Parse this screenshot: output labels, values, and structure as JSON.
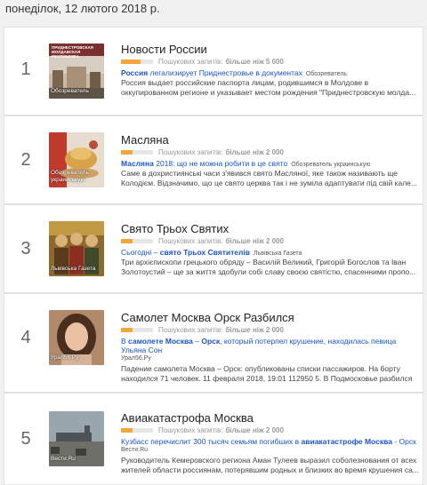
{
  "header": {
    "date": "понеділок, 12 лютого 2018 р."
  },
  "cards": [
    {
      "rank": "1",
      "title": "Новости России",
      "volume_label": "Пошукових запитів:",
      "volume_value": "більше ніж 5 000",
      "volume_fill": 0.6,
      "thumb_caption": "Обозреватель",
      "thumb_top_text": "ПРИДНЕСТРОВСКАЯ МОЛДАВСКАЯ РЕСПУБЛИКА",
      "article_title_parts": [
        "Россия",
        " легализирует Приднестровье в документах"
      ],
      "article_source": "Обозреватель",
      "snippet": "Россия выдает российские паспорта лицам, родившимся в Молдове в оккупированном регионе и указывает местом рождения \"Приднестровскую молда..."
    },
    {
      "rank": "2",
      "title": "Масляна",
      "volume_label": "Пошукових запитів:",
      "volume_value": "більше ніж 2 000",
      "volume_fill": 0.35,
      "thumb_caption": "Обозреватель украинськую",
      "article_title_parts": [
        "Масляна",
        " 2018: що не можна робити в це свято"
      ],
      "article_source": "Обозреватель украинськую",
      "snippet": "Саме в дохристиянські часи з'явився свято Масляної, яке також називають ще Колодієм. Відзначимо, що це свято церква так і не зуміла адаптувати під свій кале..."
    },
    {
      "rank": "3",
      "title": "Свято Трьох Святих",
      "volume_label": "Пошукових запитів:",
      "volume_value": "більше ніж 2 000",
      "volume_fill": 0.35,
      "thumb_caption": "Львівська Газета",
      "article_title_parts": [
        "Сьогодні – ",
        "свято Трьох Святителів"
      ],
      "article_source": "Львівська Газета",
      "snippet": "Три архієпископи грецького обряду – Василій Великий, Григорій Богослов та Іван Золотоустий – ще за життя здобули собі славу своєю святістю, спасенними пропо..."
    },
    {
      "rank": "4",
      "title": "Самолет Москва Орск Разбился",
      "volume_label": "Пошукових запитів:",
      "volume_value": "більше ніж 2 000",
      "volume_fill": 0.35,
      "thumb_caption": "Урал56.Ру",
      "article_title_parts": [
        "В ",
        "самолете Москва",
        " – ",
        "Орск",
        ", который потерпел крушение, находилась певица Ульяна Сон"
      ],
      "article_source": "Урал56.Ру",
      "snippet": "Падение самолета Москва – Орск: опубликованы списки пассажиров. На борту находился 71 человек. 11 февраля 2018, 19:01 112950 5. В Подмосковье разбился ..."
    },
    {
      "rank": "5",
      "title": "Авиакатастрофа Москва",
      "volume_label": "Пошукових запитів:",
      "volume_value": "більше ніж 2 000",
      "volume_fill": 0.35,
      "thumb_caption": "Вести.Ru",
      "article_title_parts": [
        "Кузбасс перечислит 300 тысяч семьям погибших в ",
        "авиакатастрофе Москва",
        " - Орск"
      ],
      "article_source": "Вести.Ru",
      "snippet": "Руководитель Кемеровского региона Аман Тулеев выразил соболезнования от всех жителей области россиянам, потерявшим родных и близких во время крушения са..."
    }
  ]
}
